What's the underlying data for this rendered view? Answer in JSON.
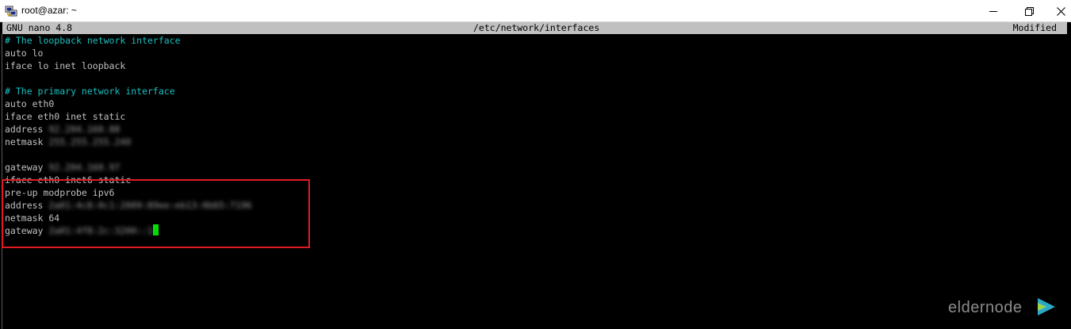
{
  "window": {
    "title": "root@azar: ~",
    "controls": {
      "minimize_icon": "minimize-icon",
      "maximize_icon": "restore-icon",
      "close_icon": "close-icon"
    }
  },
  "nano": {
    "version": "GNU nano 4.8",
    "filename": "/etc/network/interfaces",
    "status": "Modified"
  },
  "file_lines": [
    {
      "text": "# The loopback network interface",
      "type": "comment"
    },
    {
      "text": "auto lo",
      "type": "text"
    },
    {
      "text": "iface lo inet loopback",
      "type": "text"
    },
    {
      "text": "",
      "type": "blank"
    },
    {
      "text": "# The primary network interface",
      "type": "comment"
    },
    {
      "text": "auto eth0",
      "type": "text"
    },
    {
      "text": "iface eth0 inet static",
      "type": "text"
    },
    {
      "key": "address",
      "redacted": "92.204.160.88",
      "type": "redacted"
    },
    {
      "key": "netmask",
      "redacted": "255.255.255.240",
      "type": "redacted"
    },
    {
      "text": "",
      "type": "blank"
    },
    {
      "key": "gateway",
      "redacted": "92.204.160.97",
      "type": "redacted"
    },
    {
      "text": "iface eth0 inet6 static",
      "type": "text"
    },
    {
      "text": "pre-up modprobe ipv6",
      "type": "text"
    },
    {
      "key": "address",
      "redacted": "2a01:4c8:0c1:2009:89ee:eb13:0b65:7196",
      "type": "redacted"
    },
    {
      "text": "netmask 64",
      "type": "text"
    },
    {
      "key": "gateway",
      "redacted": "2a01:4f8:2c:3200::1",
      "type": "redacted"
    }
  ],
  "watermark": {
    "text": "eldernode",
    "logo_icon": "eldernode-logo-icon"
  },
  "colors": {
    "terminal_bg": "#000000",
    "text": "#c0c0c0",
    "comment": "#19c0c0",
    "header_bg": "#c0c0c0",
    "cursor": "#00e000",
    "highlight": "#e11b22"
  }
}
